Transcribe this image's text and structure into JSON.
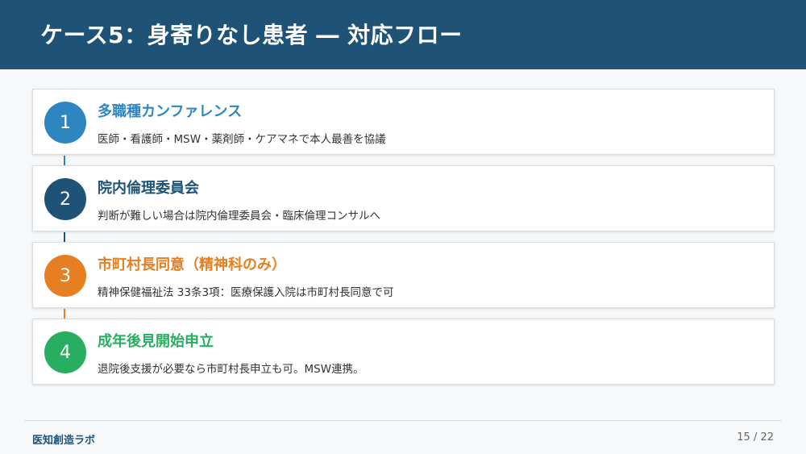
{
  "header": {
    "title": "ケース5：身寄りなし患者 ― 対応フロー"
  },
  "steps": [
    {
      "number": "1",
      "title": "多職種カンファレンス",
      "description": "医師・看護師・MSW・薬剤師・ケアマネで本人最善を協議",
      "color": "#2e86c1"
    },
    {
      "number": "2",
      "title": "院内倫理委員会",
      "description": "判断が難しい場合は院内倫理委員会・臨床倫理コンサルへ",
      "color": "#1f5277"
    },
    {
      "number": "3",
      "title": "市町村長同意（精神科のみ）",
      "description": "精神保健福祉法 33条3項：医療保護入院は市町村長同意で可",
      "color": "#e67e22"
    },
    {
      "number": "4",
      "title": "成年後見開始申立",
      "description": "退院後支援が必要なら市町村長申立も可。MSW連携。",
      "color": "#27ae60"
    }
  ],
  "footer": {
    "brand": "医知創造ラボ",
    "page": "15 / 22"
  }
}
